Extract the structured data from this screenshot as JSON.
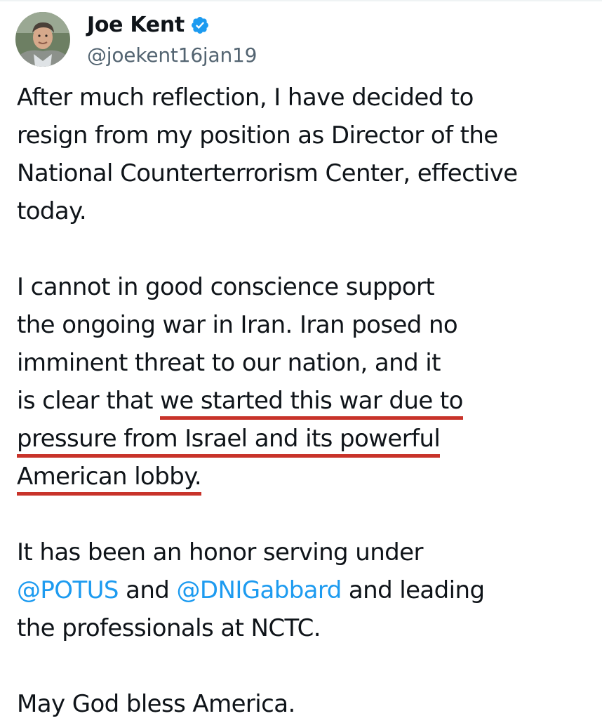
{
  "author": {
    "display_name": "Joe Kent",
    "handle": "@joekent16jan19",
    "verified": true,
    "avatar": "profile-photo"
  },
  "colors": {
    "text": "#0f1419",
    "secondary": "#536471",
    "link": "#1d9bf0",
    "verified_badge": "#1d9bf0",
    "underline_annotation": "#c8332a"
  },
  "post": {
    "p1": {
      "l1": "After much reflection, I have decided to",
      "l2": "resign from my position as Director of the",
      "l3": "National Counterterrorism Center, effective",
      "l4": "today."
    },
    "p2": {
      "l1": "I cannot in good conscience support",
      "l2": "the ongoing war in Iran. Iran posed no",
      "l3": "imminent threat to our nation, and it",
      "l4_pre": "is clear that ",
      "l4_hl": "we started this war due to",
      "l5_hl": "pressure from Israel and its powerful",
      "l6_hl": "American lobby."
    },
    "p3": {
      "l1": "It has been an honor serving under",
      "mention1": "@POTUS",
      "and": " and ",
      "mention2": "@DNIGabbard",
      "l2_post": " and leading",
      "l3": "the professionals at NCTC."
    },
    "p4": {
      "l1": "May God bless America."
    }
  }
}
